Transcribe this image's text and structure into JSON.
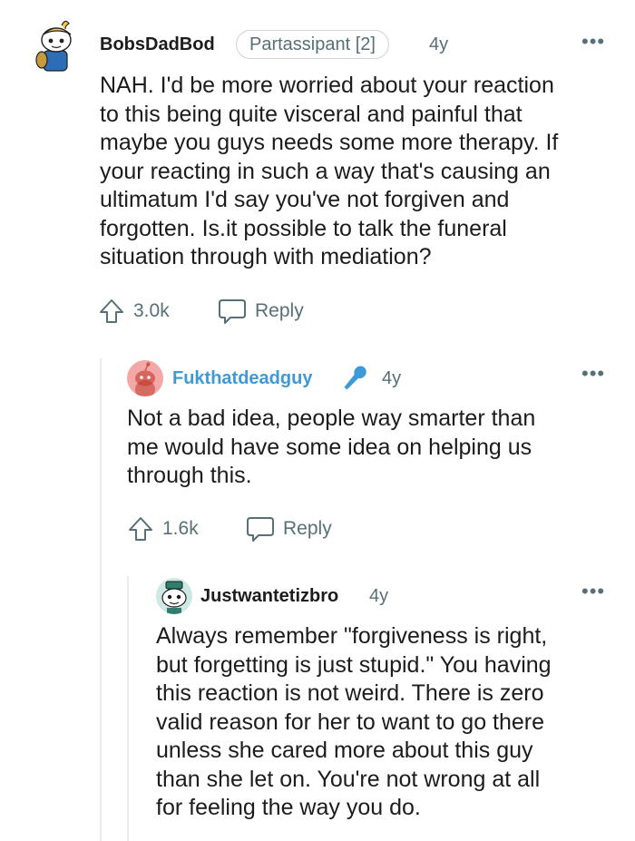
{
  "comments": [
    {
      "username": "BobsDadBod",
      "flair": "Partassipant [2]",
      "age": "4y",
      "more_icon": "more-dots-icon",
      "lines": [
        "NAH. I'd be more worried about your reaction",
        "to this being quite visceral and painful that",
        "maybe you guys needs some more therapy. If",
        "your reacting in such a way that's causing an",
        "ultimatum I'd say you've not forgiven and",
        "forgotten. Is.it possible to talk the funeral",
        "situation through with mediation?"
      ],
      "upvotes": "3.0k",
      "reply_label": "Reply"
    },
    {
      "username": "Fukthatdeadguy",
      "username_color": "#3d9ad7",
      "badge_icon": "microphone-icon",
      "age": "4y",
      "lines": [
        "Not a bad idea, people way smarter than",
        "me would have some idea on helping us",
        "through this."
      ],
      "upvotes": "1.6k",
      "reply_label": "Reply"
    },
    {
      "username": "Justwantetizbro",
      "age": "4y",
      "lines": [
        "Always remember \"forgiveness is right,",
        "but forgetting is just stupid.\" You having",
        "this reaction is not weird. There is zero",
        "valid reason for her to want to go there",
        "unless she cared more about this guy",
        "than she let on. You're not wrong at all",
        "for feeling the way you do."
      ]
    }
  ],
  "colors": {
    "text": "#1c1c1c",
    "meta": "#576f76",
    "thread_line": "#e9ebed",
    "accent_blue": "#3d9ad7"
  }
}
